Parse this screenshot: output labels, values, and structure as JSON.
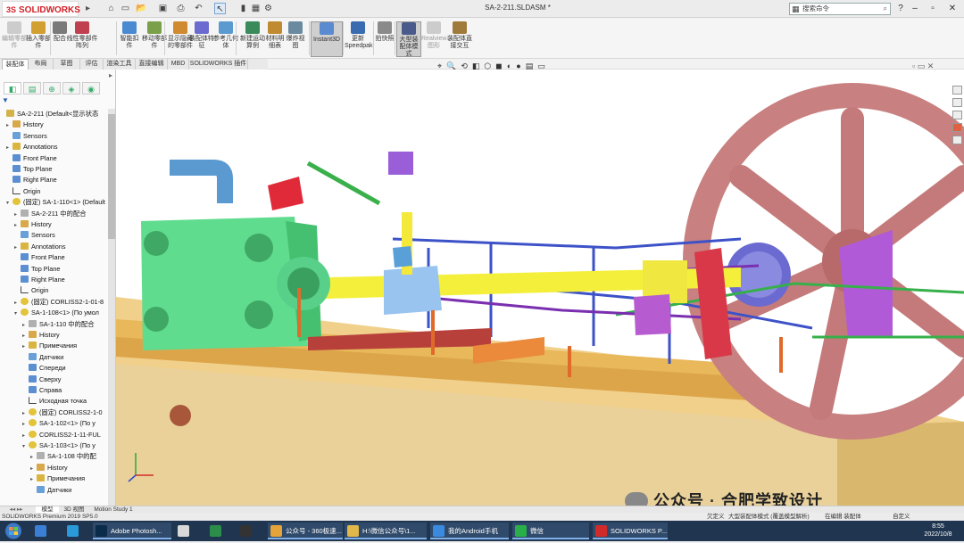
{
  "app": {
    "logo": "SOLIDWORKS",
    "logo_prefix": "3S",
    "document_title": "SA-2-211.SLDASM *",
    "search_placeholder": "搜索命令"
  },
  "ribbon": {
    "buttons": [
      {
        "label": "编辑零部件",
        "icon": "edit-component-icon",
        "dim": true
      },
      {
        "label": "插入零部件",
        "icon": "insert-component-icon",
        "dim": false
      },
      {
        "label": "配合",
        "icon": "mate-icon",
        "dim": false
      },
      {
        "label": "线性零部件阵列",
        "icon": "linear-pattern-icon",
        "dim": false
      },
      {
        "label": "智能扣件",
        "icon": "smart-fastener-icon",
        "dim": false
      },
      {
        "label": "移动零部件",
        "icon": "move-component-icon",
        "dim": false
      },
      {
        "label": "显示隐藏的零部件",
        "icon": "show-hidden-icon",
        "dim": false
      },
      {
        "label": "装配体特征",
        "icon": "assembly-feature-icon",
        "dim": false
      },
      {
        "label": "参考几何体",
        "icon": "reference-geometry-icon",
        "dim": false
      },
      {
        "label": "新建运动算例",
        "icon": "new-motion-study-icon",
        "dim": false
      },
      {
        "label": "材料明细表",
        "icon": "bom-icon",
        "dim": false
      },
      {
        "label": "爆炸视图",
        "icon": "exploded-view-icon",
        "dim": false
      },
      {
        "label": "Instant3D",
        "icon": "instant3d-icon",
        "dim": false,
        "selected": true
      },
      {
        "label": "更新 Speedpak",
        "icon": "speedpak-icon",
        "dim": false
      },
      {
        "label": "拍快照",
        "icon": "snapshot-icon",
        "dim": false
      },
      {
        "label": "大型装配体模式",
        "icon": "large-assembly-icon",
        "dim": false,
        "selected": true
      },
      {
        "label": "Realview 图形",
        "icon": "realview-icon",
        "dim": true
      },
      {
        "label": "装配体直接交互",
        "icon": "assembly-interact-icon",
        "dim": false
      }
    ]
  },
  "tabs": [
    "装配体",
    "布局",
    "草图",
    "评估",
    "渲染工具",
    "直接编辑",
    "MBD",
    "SOLIDWORKS 插件"
  ],
  "tree": {
    "root": "SA-2-211  (Default<显示状态",
    "items": [
      {
        "label": "History",
        "icon": "hist",
        "ind": 1,
        "ex": "▸"
      },
      {
        "label": "Sensors",
        "icon": "sens",
        "ind": 1,
        "ex": ""
      },
      {
        "label": "Annotations",
        "icon": "ann",
        "ind": 1,
        "ex": "▸"
      },
      {
        "label": "Front Plane",
        "icon": "plane",
        "ind": 1,
        "ex": ""
      },
      {
        "label": "Top Plane",
        "icon": "plane",
        "ind": 1,
        "ex": ""
      },
      {
        "label": "Right Plane",
        "icon": "plane",
        "ind": 1,
        "ex": ""
      },
      {
        "label": "Origin",
        "icon": "orig",
        "ind": 1,
        "ex": ""
      },
      {
        "label": "(固定) SA-1-110<1> (Default",
        "icon": "asm",
        "ind": 1,
        "ex": "▾"
      },
      {
        "label": "SA-2-211 中的配合",
        "icon": "part",
        "ind": 2,
        "ex": "▸"
      },
      {
        "label": "History",
        "icon": "hist",
        "ind": 2,
        "ex": "▸"
      },
      {
        "label": "Sensors",
        "icon": "sens",
        "ind": 2,
        "ex": ""
      },
      {
        "label": "Annotations",
        "icon": "ann",
        "ind": 2,
        "ex": "▸"
      },
      {
        "label": "Front Plane",
        "icon": "plane",
        "ind": 2,
        "ex": ""
      },
      {
        "label": "Top Plane",
        "icon": "plane",
        "ind": 2,
        "ex": ""
      },
      {
        "label": "Right Plane",
        "icon": "plane",
        "ind": 2,
        "ex": ""
      },
      {
        "label": "Origin",
        "icon": "orig",
        "ind": 2,
        "ex": ""
      },
      {
        "label": "(固定) CORLISS2-1-01-8",
        "icon": "asm",
        "ind": 2,
        "ex": "▸"
      },
      {
        "label": "SA-1-108<1> (По умол",
        "icon": "asm",
        "ind": 2,
        "ex": "▾"
      },
      {
        "label": "SA-1-110 中的配合",
        "icon": "part",
        "ind": 3,
        "ex": "▸"
      },
      {
        "label": "History",
        "icon": "hist",
        "ind": 3,
        "ex": "▸"
      },
      {
        "label": "Примечания",
        "icon": "ann",
        "ind": 3,
        "ex": "▸"
      },
      {
        "label": "Датчики",
        "icon": "sens",
        "ind": 3,
        "ex": ""
      },
      {
        "label": "Спереди",
        "icon": "plane",
        "ind": 3,
        "ex": ""
      },
      {
        "label": "Сверху",
        "icon": "plane",
        "ind": 3,
        "ex": ""
      },
      {
        "label": "Справа",
        "icon": "plane",
        "ind": 3,
        "ex": ""
      },
      {
        "label": "Исходная точка",
        "icon": "orig",
        "ind": 3,
        "ex": ""
      },
      {
        "label": "(固定) CORLISS2-1-0",
        "icon": "asm",
        "ind": 3,
        "ex": "▸"
      },
      {
        "label": "SA-1-102<1> (По у",
        "icon": "asm",
        "ind": 3,
        "ex": "▸"
      },
      {
        "label": "CORLISS2-1-11-FUL",
        "icon": "asm",
        "ind": 3,
        "ex": "▸"
      },
      {
        "label": "SA-1-103<1> (По у",
        "icon": "asm",
        "ind": 3,
        "ex": "▾"
      },
      {
        "label": "SA-1-108 中的配",
        "icon": "part",
        "ind": 4,
        "ex": "▸"
      },
      {
        "label": "History",
        "icon": "hist",
        "ind": 4,
        "ex": "▸"
      },
      {
        "label": "Примечания",
        "icon": "ann",
        "ind": 4,
        "ex": "▸"
      },
      {
        "label": "Датчики",
        "icon": "sens",
        "ind": 4,
        "ex": ""
      }
    ]
  },
  "bottom_tabs": [
    "模型",
    "3D 视图",
    "Motion Study 1"
  ],
  "status": {
    "left": "SOLIDWORKS Premium 2019 SP5.0",
    "right1": "欠定义",
    "right2": "大型装配体模式 (覆盖模型解析)",
    "right3": "在编辑 装配体",
    "right4": "自定义"
  },
  "watermark": {
    "prefix": "公众号",
    "sep": "·",
    "name": "合肥学致设计"
  },
  "taskbar": {
    "items": [
      {
        "label": "",
        "color": "#3a7fd5"
      },
      {
        "label": "",
        "color": "#2a9ad8"
      },
      {
        "label": "Adobe Photosh...",
        "color": "#0b2b4a"
      },
      {
        "label": "",
        "color": "#d8d8d8"
      },
      {
        "label": "",
        "color": "#2c8c4a"
      },
      {
        "label": "",
        "color": "#333"
      },
      {
        "label": "公众号 - 360极速...",
        "color": "#e5a33a"
      },
      {
        "label": "H:\\微信公众号\\1...",
        "color": "#e0b84a"
      },
      {
        "label": "我的Android手机",
        "color": "#3a8ae0"
      },
      {
        "label": "微信",
        "color": "#2aae4a"
      },
      {
        "label": "SOLIDWORKS P...",
        "color": "#d12a2a"
      }
    ],
    "time": "8:55",
    "date": "2022/10/8"
  }
}
